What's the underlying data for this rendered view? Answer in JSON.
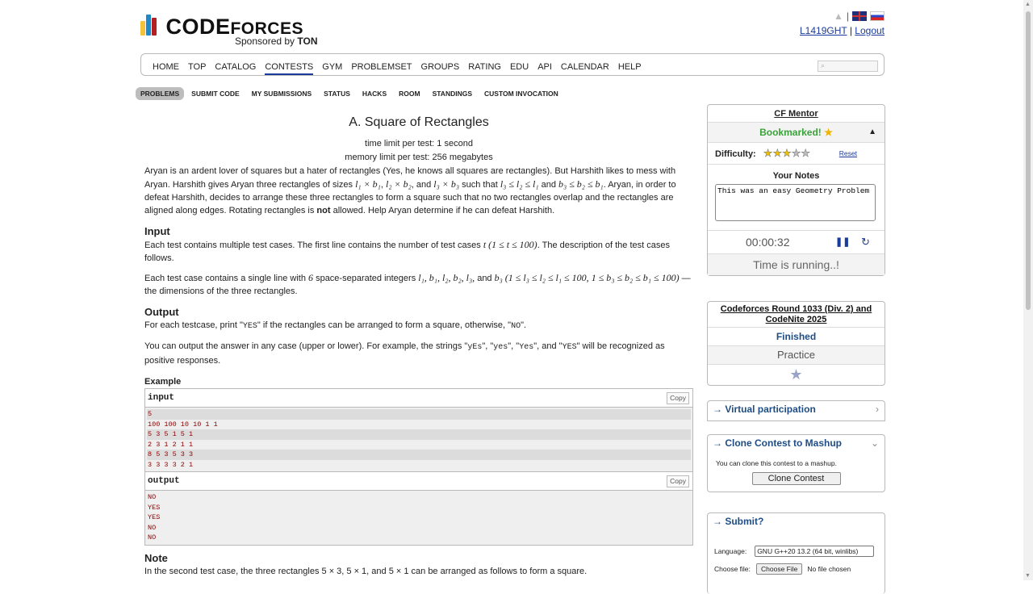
{
  "header": {
    "logo_main": "CODE",
    "logo_sub": "FORCES",
    "sponsor_prefix": "Sponsored by",
    "sponsor_name": "TON",
    "username": "L1419GHT",
    "separator": "|",
    "logout": "Logout",
    "logo_colors": [
      "#f5c33b",
      "#1f89c7",
      "#b41f24"
    ]
  },
  "menu": {
    "items": [
      "HOME",
      "TOP",
      "CATALOG",
      "CONTESTS",
      "GYM",
      "PROBLEMSET",
      "GROUPS",
      "RATING",
      "EDU",
      "API",
      "CALENDAR",
      "HELP"
    ],
    "active": "CONTESTS"
  },
  "submenu": {
    "items": [
      "PROBLEMS",
      "SUBMIT CODE",
      "MY SUBMISSIONS",
      "STATUS",
      "HACKS",
      "ROOM",
      "STANDINGS",
      "CUSTOM INVOCATION"
    ],
    "active": "PROBLEMS"
  },
  "problem": {
    "title": "A. Square of Rectangles",
    "time_limit": "time limit per test: 1 second",
    "memory_limit": "memory limit per test: 256 megabytes",
    "statement_1": "Aryan is an ardent lover of squares but a hater of rectangles (Yes, he knows all squares are rectangles). But Harshith likes to mess with Aryan. Harshith gives Aryan three rectangles of sizes ",
    "statement_m1": "l₁ × b₁",
    "statement_m2": "l₂ × b₂",
    "statement_m3": "l₃ × b₃",
    "statement_2": " such that ",
    "statement_m4": "l₃ ≤ l₂ ≤ l₁",
    "statement_and": " and ",
    "statement_m5": "b₃ ≤ b₂ ≤ b₁",
    "statement_3": ". Aryan, in order to defeat Harshith, decides to arrange these three rectangles to form a square such that no two rectangles overlap and the rectangles are aligned along edges. Rotating rectangles is ",
    "statement_not": "not",
    "statement_4": " allowed. Help Aryan determine if he can defeat Harshith.",
    "input_title": "Input",
    "input_p1a": "Each test contains multiple test cases. The first line contains the number of test cases ",
    "input_p1m": "t (1 ≤ t ≤ 100)",
    "input_p1b": ". The description of the test cases follows.",
    "input_p2a": "Each test case contains a single line with ",
    "input_p2m1": "6",
    "input_p2b": " space-separated integers ",
    "input_p2m2": "l₁, b₁, l₂, b₂, l₃,",
    "input_p2c": " and ",
    "input_p2m3": "b₃ (1 ≤ l₃ ≤ l₂ ≤ l₁ ≤ 100,",
    "input_p2m4": "1 ≤ b₃ ≤ b₂ ≤ b₁ ≤ 100)",
    "input_p2d": " — the dimensions of the three rectangles.",
    "output_title": "Output",
    "output_p1a": "For each testcase, print \"",
    "output_yes": "YES",
    "output_p1b": "\" if the rectangles can be arranged to form a square, otherwise, \"",
    "output_no": "NO",
    "output_p1c": "\".",
    "output_p2a": "You can output the answer in any case (upper or lower). For example, the strings \"",
    "output_v1": "yEs",
    "output_v2": "yes",
    "output_v3": "Yes",
    "output_v4": "YES",
    "output_p2sep": "\", \"",
    "output_p2and": "\", and \"",
    "output_p2b": "\" will be recognized as positive responses.",
    "example_title": "Example",
    "input_label": "input",
    "output_label": "output",
    "copy_label": "Copy",
    "input_lines": [
      "5",
      "100 100 10 10 1 1",
      "5 3 5 1 5 1",
      "2 3 1 2 1 1",
      "8 5 3 5 3 3",
      "3 3 3 3 2 1"
    ],
    "output_lines": [
      "NO",
      "YES",
      "YES",
      "NO",
      "NO"
    ],
    "note_title": "Note",
    "note_text": "In the second test case, the three rectangles 5 × 3, 5 × 1, and 5 × 1 can be arranged as follows to form a square."
  },
  "mentor": {
    "title": "CF Mentor",
    "bookmarked": "Bookmarked!",
    "bookmark_star": "★",
    "collapse": "▲",
    "difficulty_label": "Difficulty:",
    "difficulty_rating": 3,
    "difficulty_max": 5,
    "reset": "Reset",
    "notes_label": "Your Notes",
    "notes_value": "This was an easy Geometry Problem",
    "timer": "00:00:32",
    "pause_icon": "pause-icon",
    "reset_icon": "reset-icon",
    "status": "Time is running..!"
  },
  "contest": {
    "title": "Codeforces Round 1033 (Div. 2) and CodeNite 2025",
    "status": "Finished",
    "mode": "Practice"
  },
  "virtual": {
    "title": "→ Virtual participation"
  },
  "clone": {
    "title": "→ Clone Contest to Mashup",
    "text": "You can clone this contest to a mashup.",
    "button": "Clone Contest"
  },
  "submit": {
    "title": "→ Submit?",
    "language_label": "Language:",
    "language_value": "GNU G++20 13.2 (64 bit, winlibs)",
    "file_label": "Choose file:",
    "file_button": "Choose File",
    "file_status": "No file chosen"
  }
}
